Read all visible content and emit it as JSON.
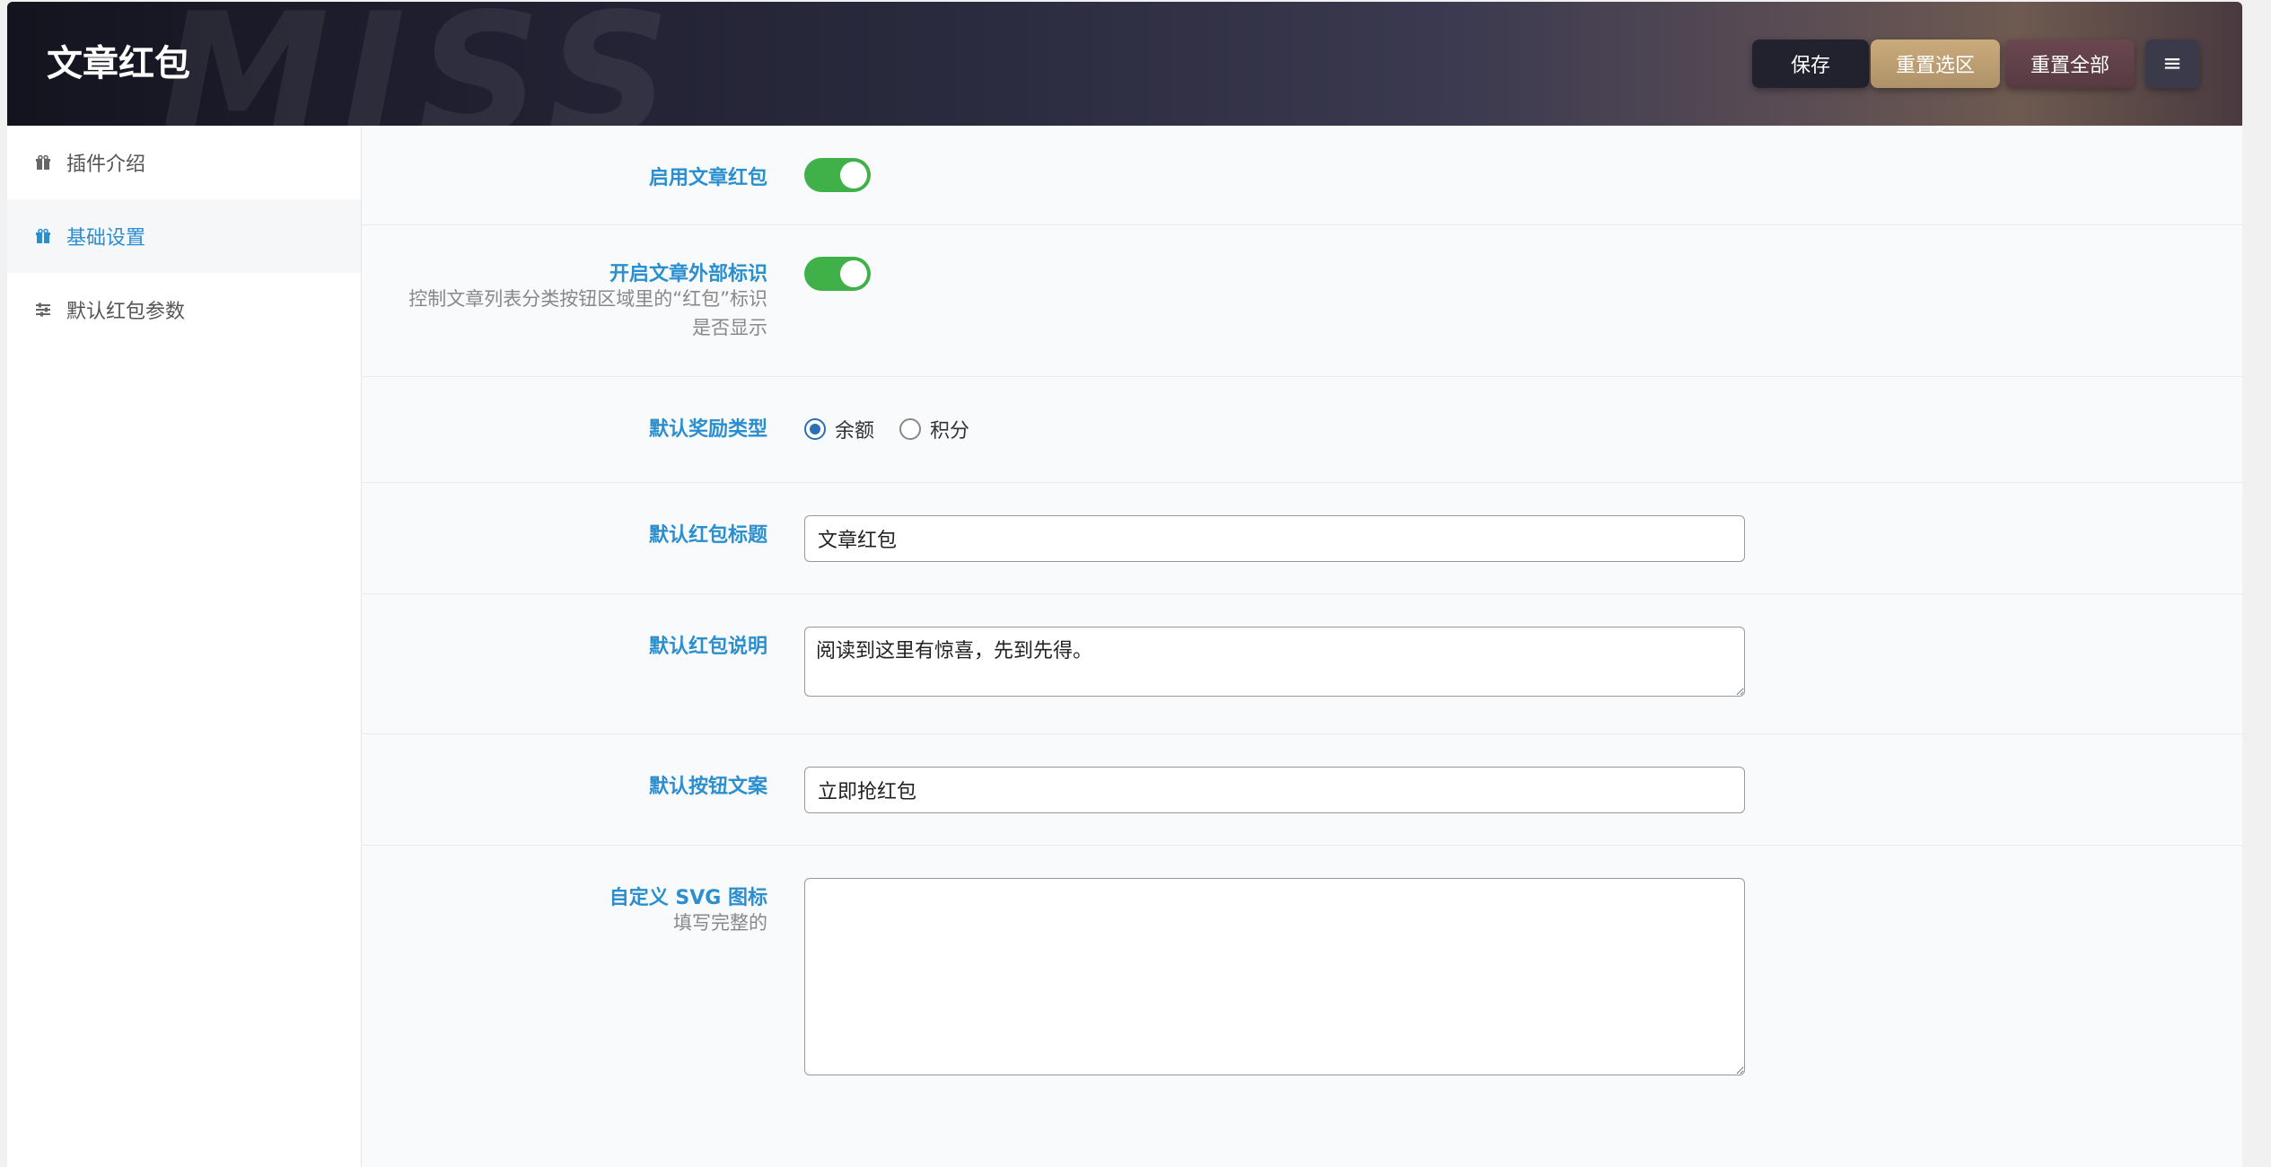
{
  "header": {
    "title": "文章红包",
    "watermark": "MISS",
    "buttons": {
      "save": "保存",
      "reset_section": "重置选区",
      "reset_all": "重置全部",
      "menu_icon": "≡"
    }
  },
  "sidebar": {
    "items": [
      {
        "label": "插件介绍",
        "icon": "gift-icon",
        "active": false
      },
      {
        "label": "基础设置",
        "icon": "gift-icon",
        "active": true
      },
      {
        "label": "默认红包参数",
        "icon": "sliders-icon",
        "active": false
      }
    ]
  },
  "form": {
    "enable": {
      "label": "启用文章红包",
      "on": true
    },
    "external_mark": {
      "label": "开启文章外部标识",
      "desc": "控制文章列表分类按钮区域里的“红包”标识是否显示",
      "on": true
    },
    "reward_type": {
      "label": "默认奖励类型",
      "options": [
        "余额",
        "积分"
      ],
      "selected": "余额"
    },
    "title": {
      "label": "默认红包标题",
      "value": "文章红包"
    },
    "description": {
      "label": "默认红包说明",
      "value": "阅读到这里有惊喜，先到先得。"
    },
    "button_text": {
      "label": "默认按钮文案",
      "value": "立即抢红包"
    },
    "svg_icon": {
      "label": "自定义 SVG 图标",
      "desc": "填写完整的",
      "value": ""
    }
  },
  "colors": {
    "accent": "#2b8fcf",
    "toggle_on": "#3fb148"
  }
}
